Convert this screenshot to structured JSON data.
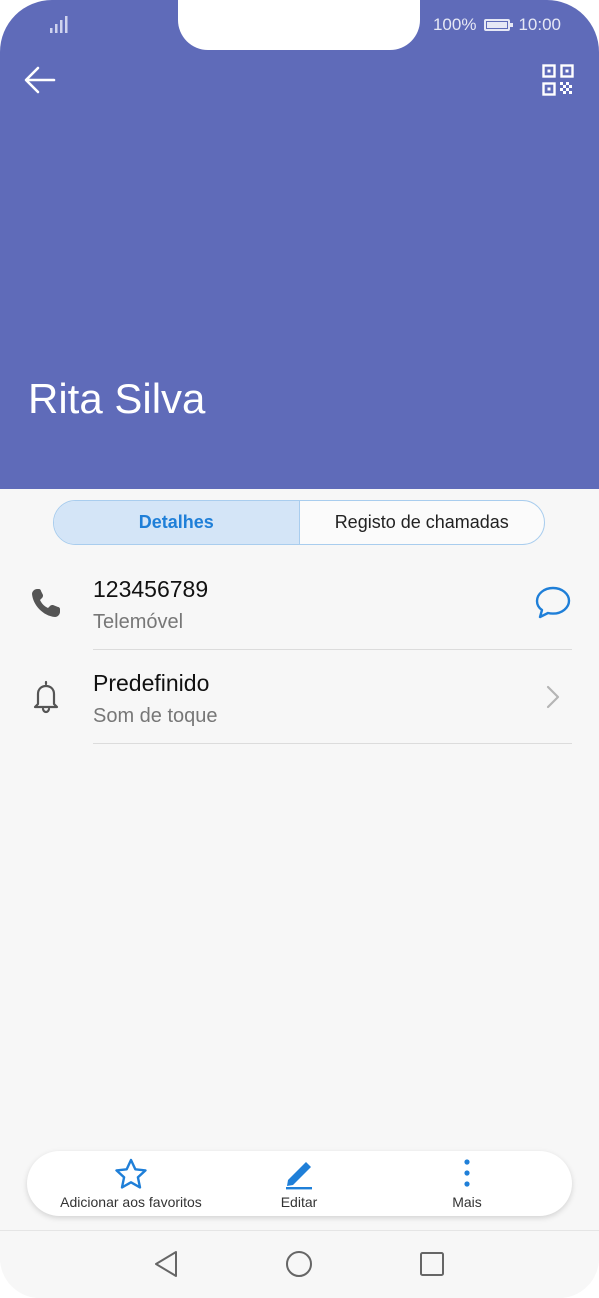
{
  "status": {
    "battery_pct": "100%",
    "time": "10:00"
  },
  "contact": {
    "name": "Rita Silva"
  },
  "tabs": [
    {
      "label": "Detalhes",
      "active": true
    },
    {
      "label": "Registo de chamadas",
      "active": false
    }
  ],
  "details": [
    {
      "primary": "123456789",
      "secondary": "Telemóvel",
      "icon": "phone-icon",
      "action": "message-icon"
    },
    {
      "primary": "Predefinido",
      "secondary": "Som de toque",
      "icon": "bell-icon",
      "action": "chevron-right-icon"
    }
  ],
  "actions": {
    "favorite_label": "Adicionar aos favoritos",
    "edit_label": "Editar",
    "more_label": "Mais"
  },
  "colors": {
    "header": "#5f6bb9",
    "accent": "#1f7fd8"
  }
}
